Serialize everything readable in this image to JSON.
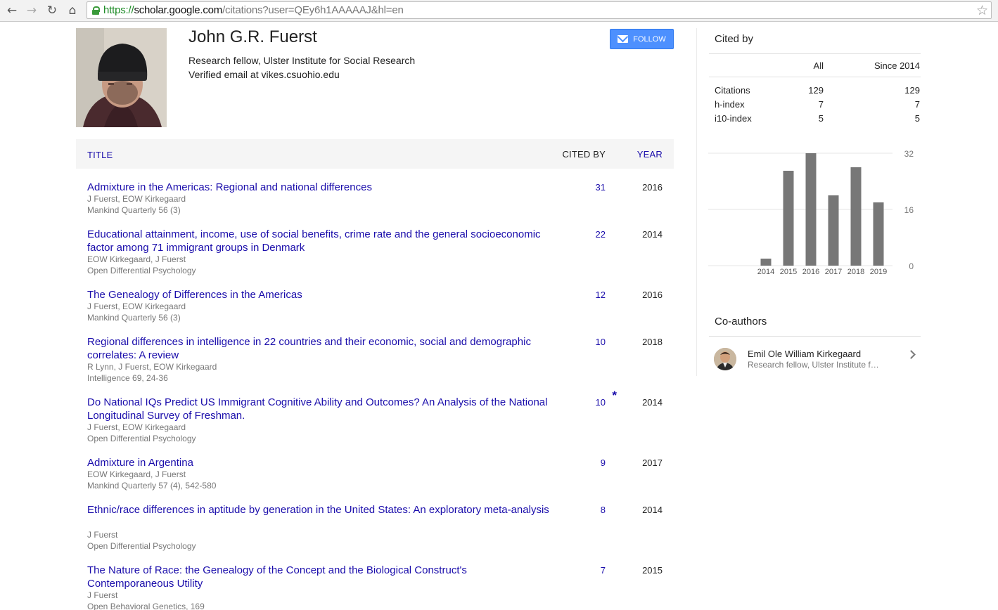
{
  "browser": {
    "url_scheme": "https://",
    "url_host": "scholar.google.com",
    "url_path": "/citations?user=QEy6h1AAAAAJ&hl=en",
    "icons": [
      "back-arrow-icon",
      "forward-arrow-icon",
      "reload-icon",
      "home-icon",
      "lock-icon",
      "star-icon"
    ]
  },
  "profile": {
    "name": "John G.R. Fuerst",
    "affiliation": "Research fellow, Ulster Institute for Social Research",
    "email": "Verified email at vikes.csuohio.edu",
    "follow_label": "FOLLOW"
  },
  "table": {
    "col_title": "TITLE",
    "col_cited": "CITED BY",
    "col_year": "YEAR",
    "rows": [
      {
        "title": "Admixture in the Americas: Regional and national differences",
        "authors": "J Fuerst, EOW Kirkegaard",
        "venue": "Mankind Quarterly 56 (3)",
        "cited": "31",
        "year": "2016",
        "mark": ""
      },
      {
        "title": "Educational attainment, income, use of social benefits, crime rate and the general socioeconomic factor among 71 immigrant groups in Denmark",
        "authors": "EOW Kirkegaard, J Fuerst",
        "venue": "Open Differential Psychology",
        "cited": "22",
        "year": "2014",
        "mark": ""
      },
      {
        "title": "The Genealogy of Differences in the Americas",
        "authors": "J Fuerst, EOW Kirkegaard",
        "venue": "Mankind Quarterly 56 (3)",
        "cited": "12",
        "year": "2016",
        "mark": ""
      },
      {
        "title": "Regional differences in intelligence in 22 countries and their economic, social and demographic correlates: A review",
        "authors": "R Lynn, J Fuerst, EOW Kirkegaard",
        "venue": "Intelligence 69, 24-36",
        "cited": "10",
        "year": "2018",
        "mark": ""
      },
      {
        "title": "Do National IQs Predict US Immigrant Cognitive Ability and Outcomes? An Analysis of the National Longitudinal Survey of Freshman.",
        "authors": "J Fuerst, EOW Kirkegaard",
        "venue": "Open Differential Psychology",
        "cited": "10",
        "year": "2014",
        "mark": "*"
      },
      {
        "title": "Admixture in Argentina",
        "authors": "EOW Kirkegaard, J Fuerst",
        "venue": "Mankind Quarterly 57 (4), 542-580",
        "cited": "9",
        "year": "2017",
        "mark": ""
      },
      {
        "title": "Ethnic/race differences in aptitude by generation in the United States: An exploratory meta-analysis",
        "authors": "J Fuerst",
        "venue": "Open Differential Psychology",
        "cited": "8",
        "year": "2014",
        "mark": ""
      },
      {
        "title": "The Nature of Race: the Genealogy of the Concept and the Biological Construct's Contemporaneous Utility",
        "authors": "J Fuerst",
        "venue": "Open Behavioral Genetics, 169",
        "cited": "7",
        "year": "2015",
        "mark": ""
      }
    ]
  },
  "cited_by": {
    "heading": "Cited by",
    "col_all": "All",
    "col_since": "Since 2014",
    "metrics": [
      {
        "label": "Citations",
        "all": "129",
        "since": "129"
      },
      {
        "label": "h-index",
        "all": "7",
        "since": "7"
      },
      {
        "label": "i10-index",
        "all": "5",
        "since": "5"
      }
    ]
  },
  "chart_data": {
    "type": "bar",
    "categories": [
      "2014",
      "2015",
      "2016",
      "2017",
      "2018",
      "2019"
    ],
    "values": [
      2,
      27,
      32,
      20,
      28,
      18
    ],
    "ylim": [
      0,
      32
    ],
    "yticks": [
      "32",
      "16",
      "0"
    ],
    "grid": true,
    "bar_color": "#777777"
  },
  "coauthors": {
    "heading": "Co-authors",
    "items": [
      {
        "name": "Emil Ole William Kirkegaard",
        "affiliation": "Research fellow, Ulster Institute for Social Research"
      }
    ]
  }
}
